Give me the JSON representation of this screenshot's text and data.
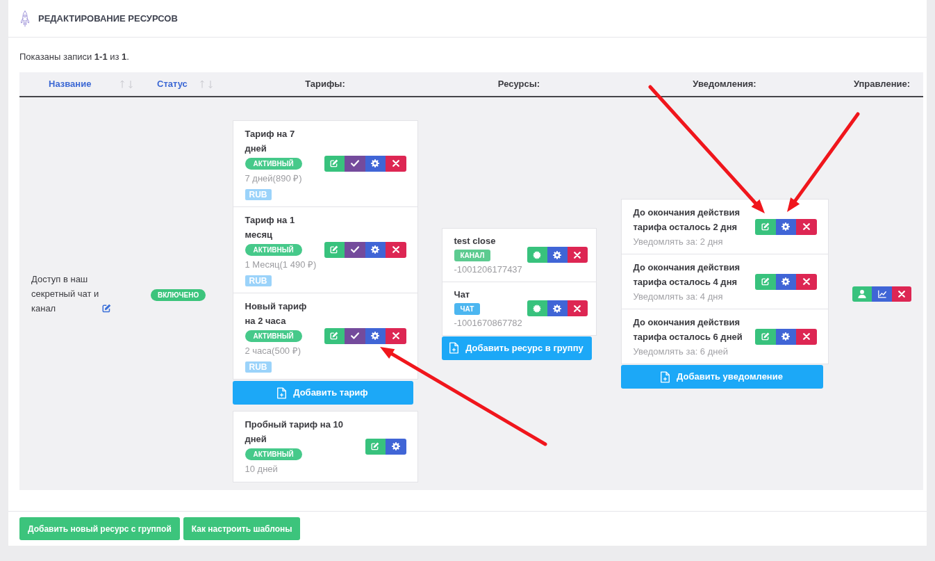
{
  "header": {
    "title": "РЕДАКТИРОВАНИЕ РЕСУРСОВ"
  },
  "summary": "Показаны записи **1-1** из **1**.",
  "table": {
    "columns": [
      {
        "label": "Название",
        "sortable": true
      },
      {
        "label": "Статус",
        "sortable": true
      },
      {
        "label": "Тарифы:",
        "sortable": false
      },
      {
        "label": "Ресурсы:",
        "sortable": false
      },
      {
        "label": "Уведомления:",
        "sortable": false
      },
      {
        "label": "Управление:",
        "sortable": false
      }
    ],
    "rows": [
      {
        "name": "Доступ в наш секретный чат и канал",
        "status": "ВКЛЮЧЕНО",
        "tariffs": [
          {
            "title": "Тариф на 7 дней",
            "status": "АКТИВНЫЙ",
            "period": "7 дней(890 ₽)",
            "currency": "RUB",
            "actions": [
              {
                "kind": "edit"
              },
              {
                "kind": "check"
              },
              {
                "kind": "settings"
              },
              {
                "kind": "delete"
              }
            ]
          },
          {
            "title": "Тариф на 1 месяц",
            "status": "АКТИВНЫЙ",
            "period": "1 Месяц(1 490 ₽)",
            "currency": "RUB",
            "actions": [
              {
                "kind": "edit"
              },
              {
                "kind": "check"
              },
              {
                "kind": "settings"
              },
              {
                "kind": "delete"
              }
            ]
          },
          {
            "title": "Новый тариф на 2 часа",
            "status": "АКТИВНЫЙ",
            "period": "2 часа(500 ₽)",
            "currency": "RUB",
            "actions": [
              {
                "kind": "edit"
              },
              {
                "kind": "check"
              },
              {
                "kind": "settings",
                "arrow": {
                  "kind": "from-lower-right"
                }
              },
              {
                "kind": "delete"
              }
            ]
          }
        ],
        "add_tariff_button": "Добавить тариф",
        "trial_tariff": {
          "title": "Пробный тариф на 10 дней",
          "status": "АКТИВНЫЙ",
          "period": "10 дней",
          "actions": [
            {
              "kind": "edit"
            },
            {
              "kind": "settings"
            }
          ]
        },
        "resources": [
          {
            "title": "test close",
            "type": "КАНАЛ",
            "color": "#5ccb90",
            "id": "-1001206177437",
            "actions": [
              {
                "kind": "seal"
              },
              {
                "kind": "settings"
              },
              {
                "kind": "delete"
              }
            ]
          },
          {
            "title": "Чат",
            "type": "ЧАТ",
            "color": "#4cb6f0",
            "id": "-1001670867782",
            "actions": [
              {
                "kind": "seal"
              },
              {
                "kind": "settings"
              },
              {
                "kind": "delete"
              }
            ]
          }
        ],
        "add_resource_button": "Добавить ресурс в группу",
        "notifications": [
          {
            "title": "До окончания действия тарифа осталось 2 дня",
            "subtitle": "Уведомлять за: 2 дня",
            "actions": [
              {
                "kind": "edit",
                "arrow": {
                  "kind": "from-upper-left"
                }
              },
              {
                "kind": "settings",
                "arrow": {
                  "kind": "from-upper-right"
                }
              },
              {
                "kind": "delete"
              }
            ]
          },
          {
            "title": "До окончания действия тарифа осталось 4 дня",
            "subtitle": "Уведомлять за: 4 дня",
            "actions": [
              {
                "kind": "edit"
              },
              {
                "kind": "settings"
              },
              {
                "kind": "delete"
              }
            ]
          },
          {
            "title": "До окончания действия тарифа осталось 6 дней",
            "subtitle": "Уведомлять за: 6 дней",
            "actions": [
              {
                "kind": "edit"
              },
              {
                "kind": "settings"
              },
              {
                "kind": "delete"
              }
            ]
          }
        ],
        "add_notification_button": "Добавить уведомление",
        "management": [
          {
            "kind": "user"
          },
          {
            "kind": "chart"
          },
          {
            "kind": "delete"
          }
        ]
      }
    ]
  },
  "footer_buttons": [
    "Добавить новый ресурс с группой",
    "Как настроить шаблоны"
  ]
}
